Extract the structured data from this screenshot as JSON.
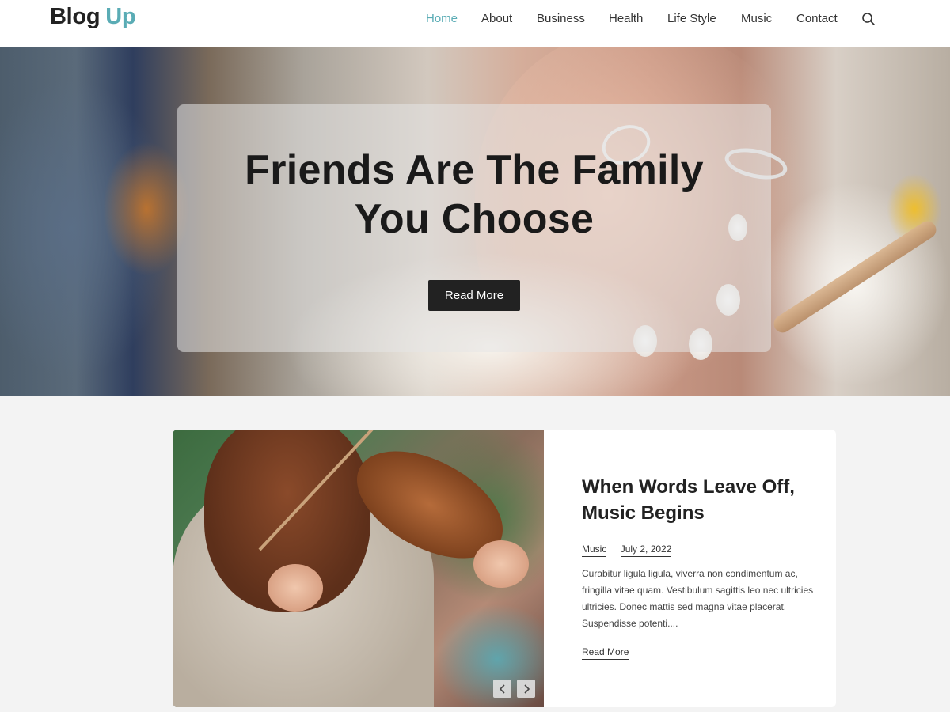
{
  "header": {
    "logo_part1": "Blog",
    "logo_part2": "Up",
    "nav": [
      "Home",
      "About",
      "Business",
      "Health",
      "Life Style",
      "Music",
      "Contact"
    ],
    "active_nav": "Home"
  },
  "hero": {
    "title_line1": "Friends Are The Family",
    "title_line2": "You Choose",
    "button_label": "Read More"
  },
  "featured_post": {
    "title": "When Words Leave Off, Music Begins",
    "category": "Music",
    "date": "July 2, 2022",
    "excerpt": "Curabitur ligula ligula, viverra non condimentum ac, fringilla vitae quam. Vestibulum sagittis leo nec ultricies ultricies. Donec mattis sed magna vitae placerat. Suspendisse potenti....",
    "read_more_label": "Read More"
  },
  "colors": {
    "accent": "#5aacb5",
    "text": "#222222",
    "button_bg": "#222222",
    "page_bg": "#f3f3f3"
  },
  "icons": {
    "search": "search-icon",
    "prev": "chevron-left-icon",
    "next": "chevron-right-icon"
  }
}
